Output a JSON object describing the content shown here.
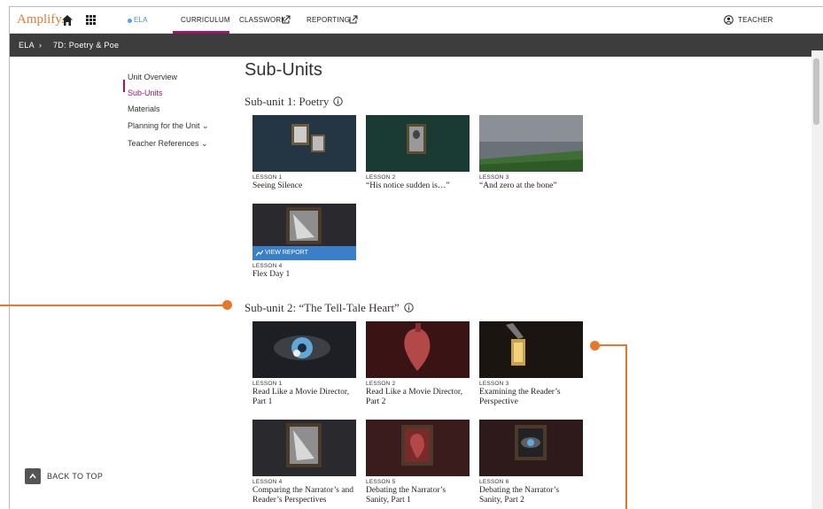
{
  "nav": {
    "logo": "Amplify.",
    "ela": "ELA",
    "curriculum": "CURRICULUM",
    "classwork": "CLASSWORK",
    "reporting": "REPORTING",
    "user": "TEACHER"
  },
  "breadcrumb": {
    "root": "ELA",
    "separator": "›",
    "unit": "7D: Poetry & Poe"
  },
  "sidebar": {
    "items": [
      {
        "label": "Unit Overview"
      },
      {
        "label": "Sub-Units"
      },
      {
        "label": "Materials"
      },
      {
        "label": "Planning for the Unit ⌄"
      },
      {
        "label": "Teacher References ⌄"
      }
    ]
  },
  "main": {
    "title": "Sub-Units",
    "subunits": [
      {
        "title": "Sub-unit 1: Poetry",
        "lessons": [
          {
            "num": "LESSON 1",
            "title": "Seeing Silence"
          },
          {
            "num": "LESSON 2",
            "title": "“His notice sudden is…”"
          },
          {
            "num": "LESSON 3",
            "title": "“And zero at the bone”"
          },
          {
            "num": "LESSON 4",
            "title": "Flex Day 1",
            "report": "VIEW REPORT"
          }
        ]
      },
      {
        "title": "Sub-unit 2: “The Tell-Tale Heart”",
        "lessons": [
          {
            "num": "LESSON 1",
            "title": "Read Like a Movie Director, Part 1"
          },
          {
            "num": "LESSON 2",
            "title": "Read Like a Movie Director, Part 2"
          },
          {
            "num": "LESSON 3",
            "title": "Examining the Reader’s Perspective"
          },
          {
            "num": "LESSON 4",
            "title": "Comparing the Narrator’s and Reader’s Perspectives"
          },
          {
            "num": "LESSON 5",
            "title": "Debating the Narrator’s Sanity, Part 1"
          },
          {
            "num": "LESSON 6",
            "title": "Debating the Narrator’s Sanity, Part 2"
          }
        ]
      }
    ]
  },
  "back_to_top": "BACK TO TOP",
  "colors": {
    "brand": "#e07b39",
    "accent": "#a3136b",
    "link": "#3f8ed8",
    "annotation": "#e8772e",
    "report": "#3b7fc8"
  },
  "icons": [
    "home-icon",
    "apps-grid-icon",
    "external-link-icon",
    "user-circle-icon",
    "info-icon",
    "chart-trend-icon",
    "chevron-up-icon"
  ]
}
